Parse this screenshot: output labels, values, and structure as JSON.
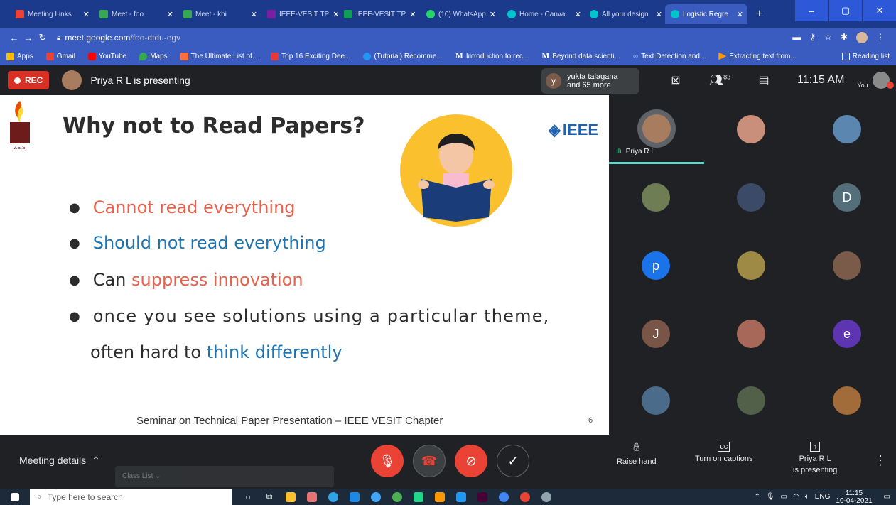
{
  "browser": {
    "tabs": [
      {
        "label": "Meeting Links",
        "color": "#ea4335"
      },
      {
        "label": "Meet - foo",
        "color": "#34a853"
      },
      {
        "label": "Meet - khi",
        "color": "#34a853"
      },
      {
        "label": "IEEE-VESIT TP",
        "color": "#7b1fa2"
      },
      {
        "label": "IEEE-VESIT TP",
        "color": "#0f9d58"
      },
      {
        "label": "(10) WhatsApp",
        "color": "#25d366"
      },
      {
        "label": "Home - Canva",
        "color": "#00c4cc"
      },
      {
        "label": "All your design",
        "color": "#00c4cc"
      },
      {
        "label": "Logistic Regre",
        "color": "#00c4cc"
      }
    ],
    "new_tab": "+",
    "url_host": "meet.google.com",
    "url_path": "/foo-dtdu-egv",
    "bookmarks": [
      {
        "label": "Apps",
        "color": "#fbbc05"
      },
      {
        "label": "Gmail",
        "color": "#ea4335"
      },
      {
        "label": "YouTube",
        "color": "#ff0000"
      },
      {
        "label": "Maps",
        "color": "#34a853"
      },
      {
        "label": "The Ultimate List of...",
        "color": "#ff6f3c"
      },
      {
        "label": "Top 16 Exciting Dee...",
        "color": "#e53935"
      },
      {
        "label": "(Tutorial) Recomme...",
        "color": "#2196f3"
      },
      {
        "label": "Introduction to rec...",
        "color": "#000000"
      },
      {
        "label": "Beyond data scienti...",
        "color": "#000000"
      },
      {
        "label": "Text Detection and...",
        "color": "#1a73e8"
      },
      {
        "label": "Extracting text from...",
        "color": "#ff9800"
      }
    ],
    "reading_list": "Reading list"
  },
  "meet": {
    "rec_label": "REC",
    "presenter_label": "Priya R L is presenting",
    "joiner_initial": "y",
    "joiner_name": "yukta talagana",
    "joiner_more": "and 65 more",
    "people_count": "83",
    "time": "11:15 AM",
    "you_label": "You"
  },
  "slide": {
    "title": "Why not to Read Papers?",
    "ieee_logo": "IEEE",
    "ves_logo": "V.E.S.",
    "bullets": [
      {
        "prefix": "",
        "highlight": "Cannot read everything",
        "suffix": "",
        "tone": "red"
      },
      {
        "prefix": "",
        "highlight": "Should not read everything",
        "suffix": "",
        "tone": "blue"
      },
      {
        "prefix": "Can ",
        "highlight": "suppress innovation",
        "suffix": "",
        "tone": "red"
      }
    ],
    "bullet4_line1": "once you see solutions using a particular theme,",
    "bullet4_line2_prefix": "often hard to ",
    "bullet4_line2_highlight": "think differently",
    "footer": "Seminar on Technical Paper Presentation – IEEE VESIT Chapter",
    "page_number": "6"
  },
  "participants": {
    "presenter_tile_name": "Priya R L",
    "letters": [
      "D",
      "p",
      "J",
      "e"
    ]
  },
  "controls": {
    "meeting_details": "Meeting details",
    "raise_hand": "Raise hand",
    "captions": "Turn on captions",
    "presenting_line1": "Priya R L",
    "presenting_line2": "is presenting",
    "classlist": "Class List"
  },
  "taskbar": {
    "search_placeholder": "Type here to search",
    "lang": "ENG",
    "time": "11:15",
    "date": "10-04-2021"
  }
}
